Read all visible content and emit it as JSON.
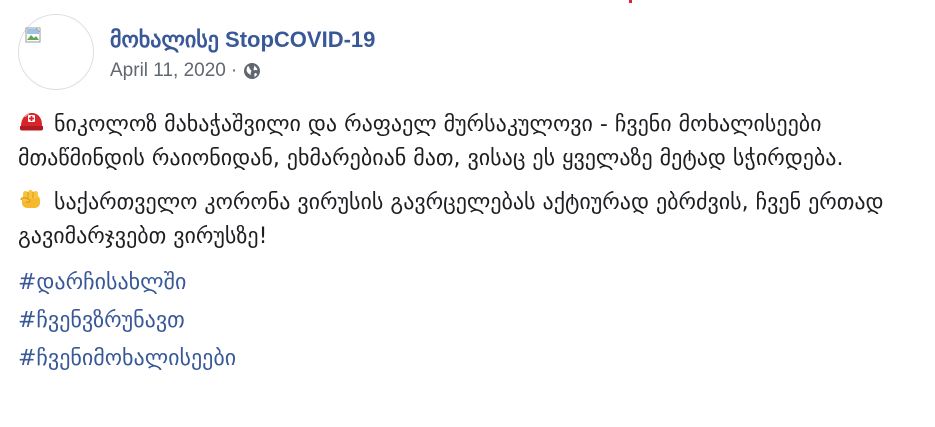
{
  "post": {
    "page_name": "მოხალისე StopCOVID-19",
    "date": "April 11, 2020",
    "separator": "·",
    "privacy_icon": "globe-icon",
    "avatar_icon": "broken-image-icon",
    "paragraphs": [
      {
        "icon": "rescue-helmet-icon",
        "text": "ნიკოლოზ მახაჭაშვილი და რაფაელ მურსაკულოვი - ჩვენი მოხალისეები მთაწმინდის რაიონიდან, ეხმარებიან მათ, ვისაც ეს ყველაზე მეტად სჭირდება."
      },
      {
        "icon": "fist-bump-icon",
        "text": "საქართველო კორონა ვირუსის გავრცელებას აქტიურად ებრძვის, ჩვენ ერთად გავიმარჯვებთ ვირუსზე!"
      }
    ],
    "hashtags": [
      "#დარჩისახლში",
      "#ჩვენვზრუნავთ",
      "#ჩვენიმოხალისეები"
    ]
  },
  "colors": {
    "link": "#385898",
    "muted": "#616770",
    "text": "#1c1e21",
    "accent_mark": "#e41e3f"
  }
}
